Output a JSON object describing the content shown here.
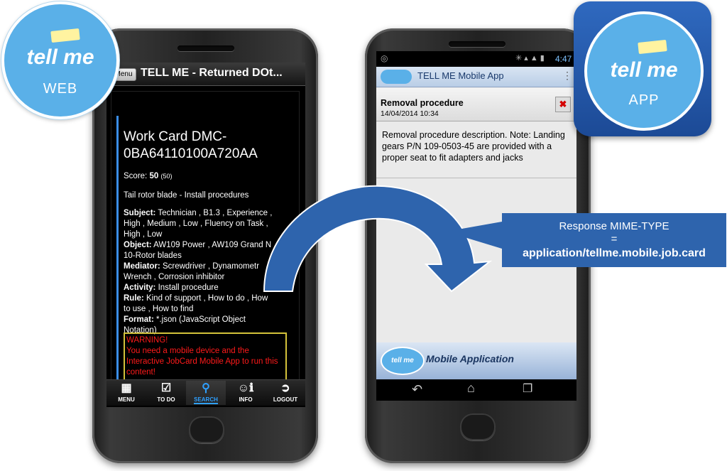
{
  "web_badge": {
    "logo": "tell me",
    "caption": "WEB"
  },
  "app_badge": {
    "logo": "tell me",
    "caption": "APP"
  },
  "web_phone": {
    "menu_button": "Menu",
    "title": "TELL ME - Returned DOt...",
    "card_title": "Work Card DMC-0BA64110100A720AA",
    "score_label": "Score:",
    "score_value": "50",
    "score_max": "(50)",
    "description": "Tail rotor blade - Install procedures",
    "fields": [
      {
        "label": "Subject:",
        "value": " Technician , B1.3 , Experience , High , Medium , Low , Fluency on Task , High , Low"
      },
      {
        "label": "Object:",
        "value": " AW109 Power , AW109 Grand N 10-Rotor blades"
      },
      {
        "label": "Mediator:",
        "value": " Screwdriver , Dynamometr Wrench , Corrosion inhibitor"
      },
      {
        "label": "Activity:",
        "value": " Install procedure"
      },
      {
        "label": "Rule:",
        "value": " Kind of support , How to do , How to use , How to find"
      },
      {
        "label": "Format:",
        "value": " *.json (JavaScript Object Notation)"
      }
    ],
    "warning": "WARNING!\nYou need a mobile device and the Interactive JobCard Mobile App to run this content!",
    "tabs": [
      {
        "label": "MENU",
        "icon": "menu-grid-icon"
      },
      {
        "label": "TO DO",
        "icon": "checklist-icon"
      },
      {
        "label": "SEARCH",
        "icon": "search-icon",
        "active": true
      },
      {
        "label": "INFO",
        "icon": "info-people-icon"
      },
      {
        "label": "LOGOUT",
        "icon": "logout-door-icon"
      }
    ]
  },
  "app_phone": {
    "status_time": "4:47",
    "app_title": "TELL ME Mobile App",
    "dialog_title": "Removal procedure",
    "dialog_date": "14/04/2014 10:34",
    "description": "Removal procedure description. Note: Landing gears P/N 109-0503-45 are provided with a proper seat to fit adapters and jacks",
    "footer_text": "Mobile Application",
    "footer_logo": "tell me"
  },
  "callout": {
    "line1": "Response MIME-TYPE",
    "line2": "=",
    "line3": "application/tellme.mobile.job.card"
  },
  "colors": {
    "accent_blue": "#2e64ad",
    "badge_blue": "#5ab0e8",
    "warning_red": "#ff1a1a"
  }
}
